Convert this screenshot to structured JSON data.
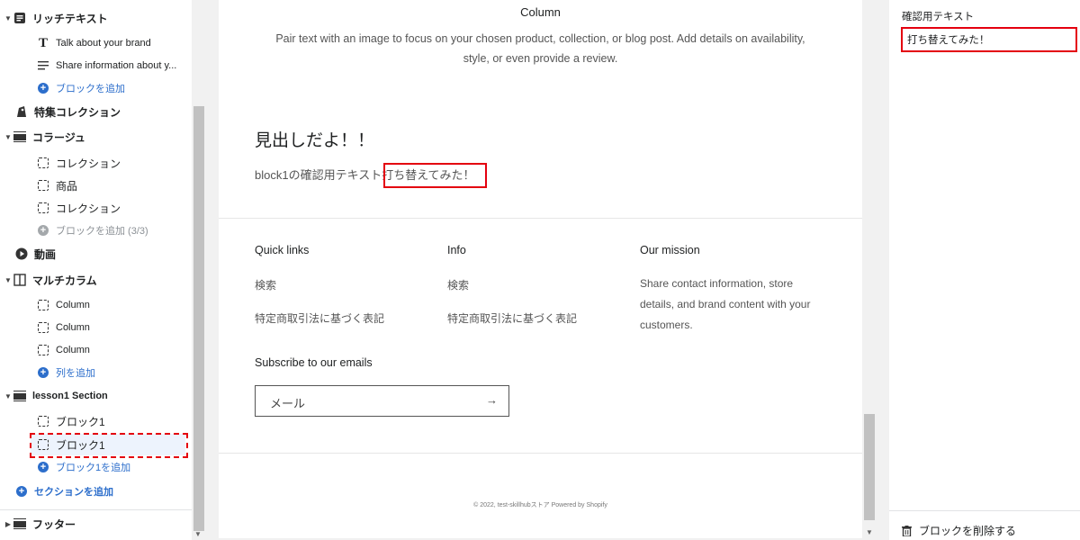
{
  "sidebar": {
    "rich_text": {
      "label": "リッチテキスト",
      "items": [
        "Talk about your brand",
        "Share information about y..."
      ],
      "add_block": "ブロックを追加"
    },
    "featured_collection": "特集コレクション",
    "collage": {
      "label": "コラージュ",
      "items": [
        "コレクション",
        "商品",
        "コレクション"
      ],
      "add_block": "ブロックを追加 (3/3)"
    },
    "video": "動画",
    "multicolumn": {
      "label": "マルチカラム",
      "items": [
        "Column",
        "Column",
        "Column"
      ],
      "add_column": "列を追加"
    },
    "lesson_section": {
      "label": "lesson1 Section",
      "items": [
        "ブロック1",
        "ブロック1"
      ],
      "add_block": "ブロック1を追加"
    },
    "add_section": "セクションを追加",
    "footer": "フッター"
  },
  "preview": {
    "column_title": "Column",
    "column_desc_line1": "Pair text with an image to focus on your chosen product, collection, or blog post. Add details on availability,",
    "column_desc_line2": "style, or even provide a review.",
    "heading": "見出しだよ！！",
    "body_prefix": "block1の確認用テキスト",
    "body_highlight": "打ち替えてみた！",
    "footer": {
      "quick_links": {
        "title": "Quick links",
        "items": [
          "検索",
          "特定商取引法に基づく表記"
        ]
      },
      "info": {
        "title": "Info",
        "items": [
          "検索",
          "特定商取引法に基づく表記"
        ]
      },
      "mission": {
        "title": "Our mission",
        "text_line1": "Share contact information, store",
        "text_line2": "details, and brand content with your",
        "text_line3": "customers."
      },
      "subscribe": {
        "title": "Subscribe to our emails",
        "placeholder": "メール",
        "arrow": "→"
      },
      "copyright": "© 2022, test-skillhubストア Powered by Shopify"
    }
  },
  "settings": {
    "field_label": "確認用テキスト",
    "field_value": "打ち替えてみた！",
    "delete_label": "ブロックを削除する"
  },
  "colors": {
    "accent": "#2c6ecb",
    "highlight": "#e4000f"
  }
}
